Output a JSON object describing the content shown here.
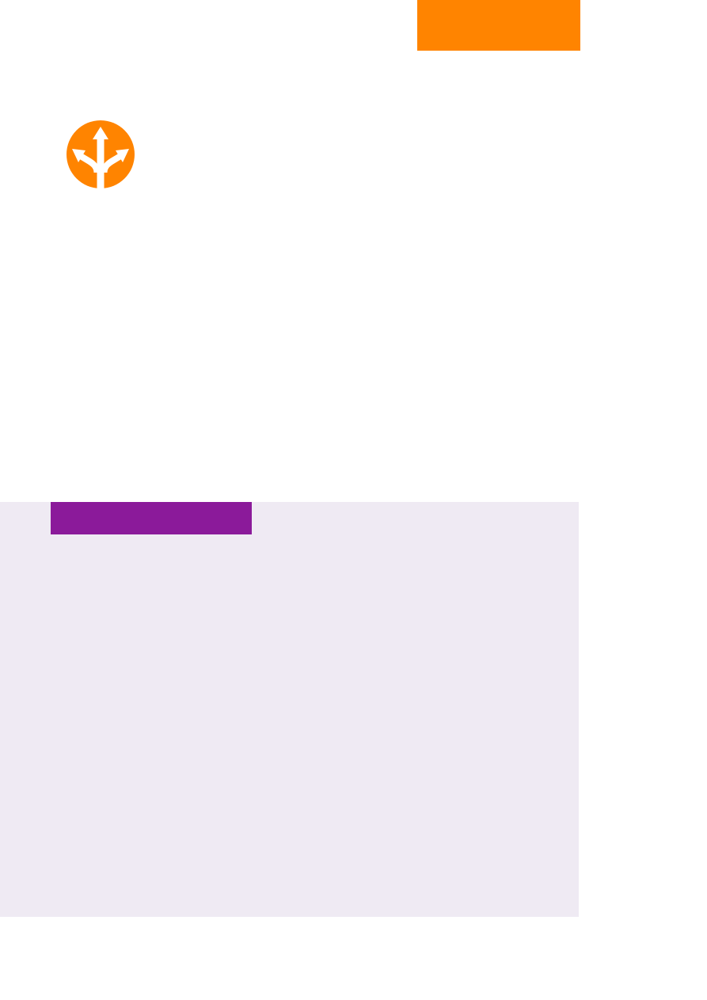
{
  "page": {
    "background_color": "#ffffff"
  },
  "header": {
    "accent_bar_color": "#ff8400"
  },
  "badge": {
    "icon": "split-arrows-icon",
    "circle_color": "#ff8400",
    "arrow_color": "#ffffff"
  },
  "panel": {
    "background_color": "#efeaf3",
    "tab_color": "#8b1a9a"
  }
}
